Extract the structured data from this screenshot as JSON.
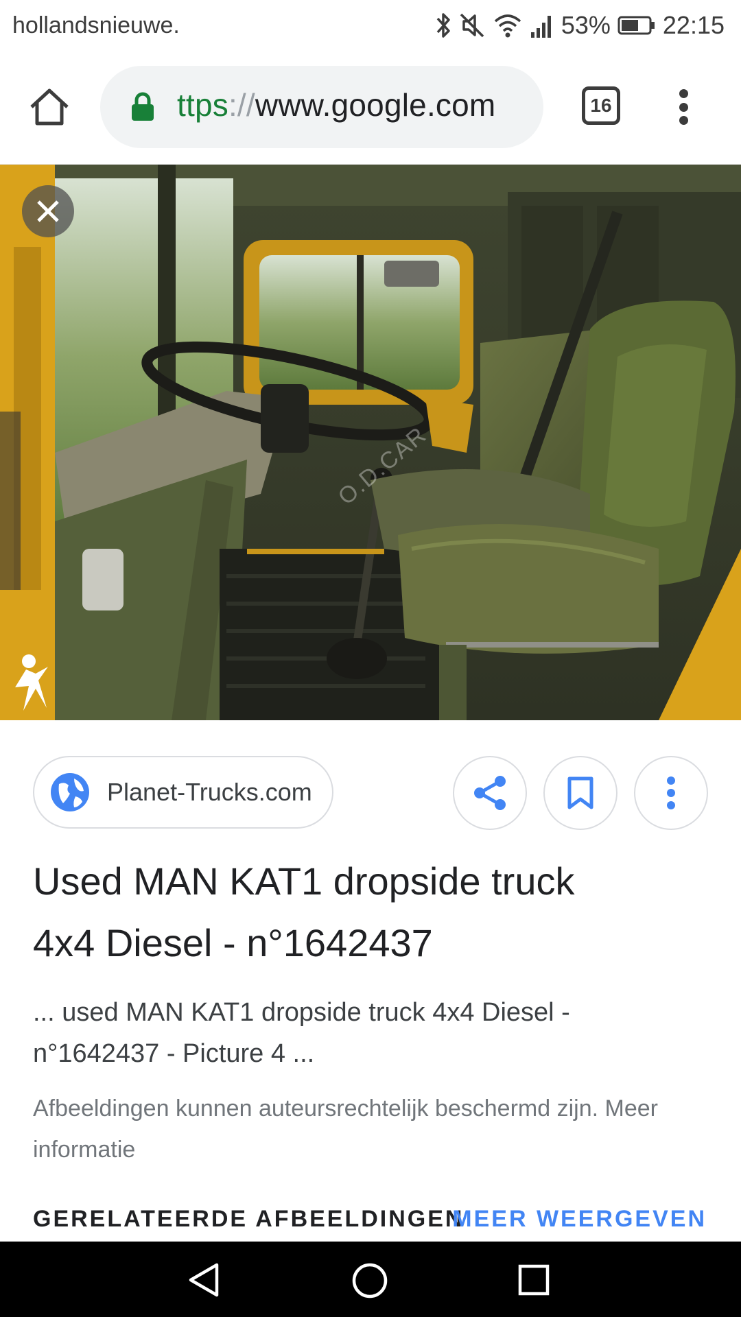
{
  "status_bar": {
    "carrier": "hollandsnieuwe.",
    "battery": "53%",
    "time": "22:15"
  },
  "browser": {
    "url_scheme": "https",
    "url_visible_scheme": "ttps",
    "url_separator": "://",
    "url_host": "www.google.com",
    "tab_count": "16"
  },
  "viewer": {
    "watermark": "O.D.CAR"
  },
  "result": {
    "source": "Planet-Trucks.com",
    "title_line1": "Used MAN KAT1 dropside truck",
    "title_line2": "4x4 Diesel - n°1642437",
    "snippet_line1": "... used MAN KAT1 dropside truck 4x4 Diesel -",
    "snippet_line2": "n°1642437 - Picture 4 ...",
    "copyright_line1": "Afbeeldingen kunnen auteursrechtelijk beschermd zijn. Meer",
    "copyright_line2": "informatie"
  },
  "related": {
    "heading": "GERELATEERDE AFBEELDINGEN",
    "more": "MEER WEERGEVEN"
  },
  "colors": {
    "accent_blue": "#4285f4",
    "secure_green": "#188038",
    "truck_yellow": "#d9a21b",
    "cab_green": "#4f5a34"
  },
  "icons": [
    "home-icon",
    "lock-icon",
    "tab-switcher-icon",
    "more-vert-icon",
    "close-icon",
    "globe-icon",
    "share-icon",
    "bookmark-icon",
    "back-icon",
    "home-circle-icon",
    "recents-icon"
  ]
}
